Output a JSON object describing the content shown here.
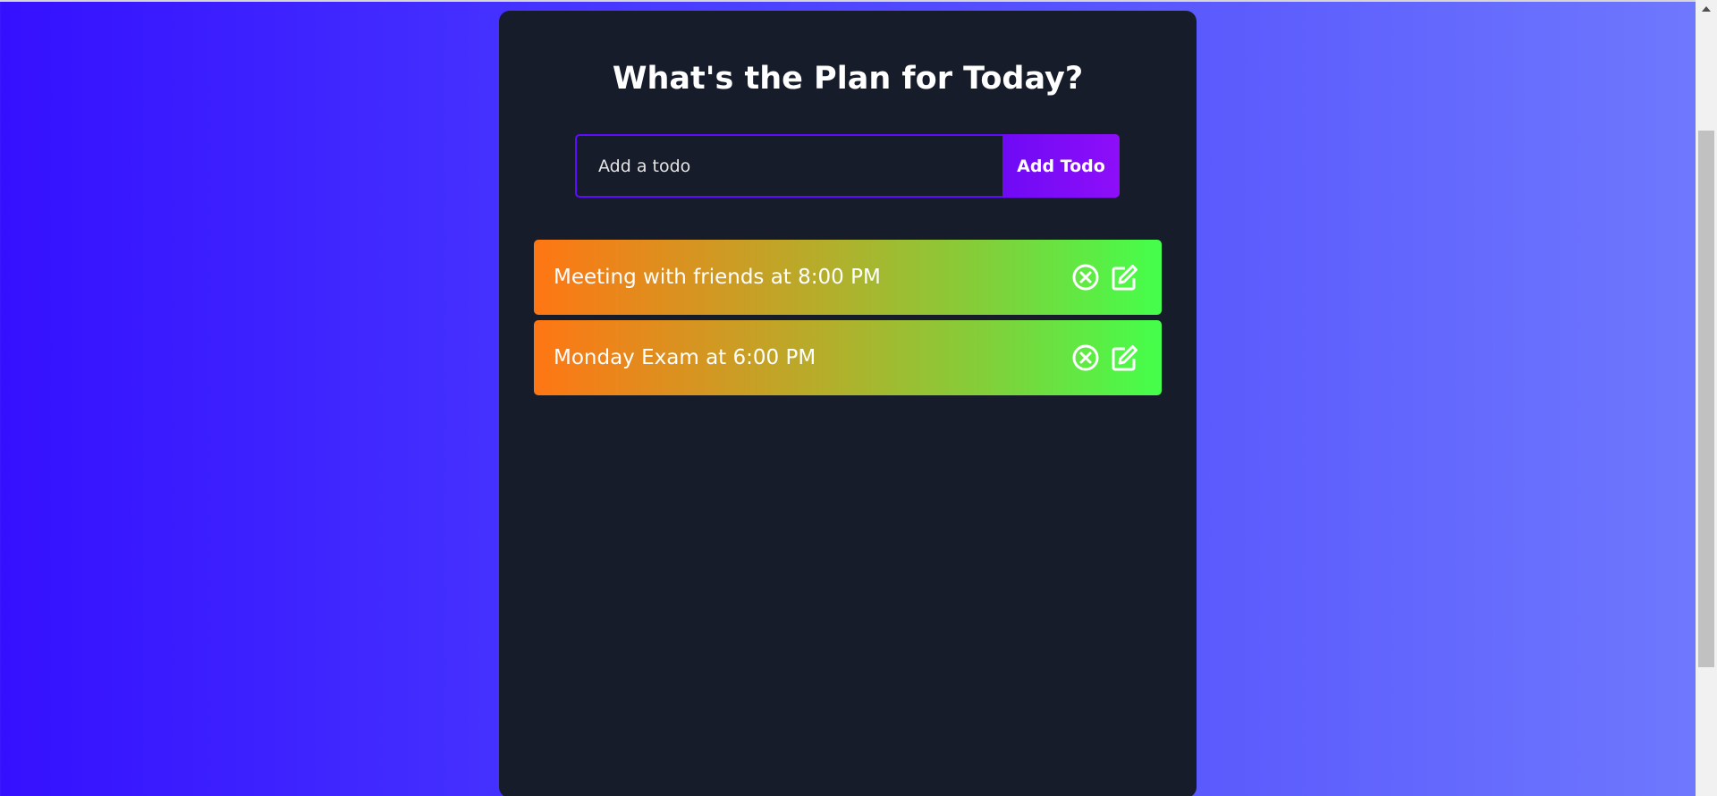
{
  "header": {
    "title": "What's the Plan for Today?"
  },
  "form": {
    "input_placeholder": "Add a todo",
    "input_value": "",
    "add_button_label": "Add Todo"
  },
  "todos": [
    {
      "text": "Meeting with friends at 8:00 PM",
      "delete_icon": "close-circle-icon",
      "edit_icon": "edit-icon"
    },
    {
      "text": "Monday Exam at 6:00 PM",
      "delete_icon": "close-circle-icon",
      "edit_icon": "edit-icon"
    }
  ],
  "colors": {
    "page_gradient_start": "#3510ff",
    "page_gradient_end": "#6f79fd",
    "panel_background": "#171c2b",
    "accent_purple": "#5d0cff",
    "button_gradient_start": "#6f0af5",
    "button_gradient_end": "#8e0ef9",
    "todo_gradient_start": "#ff7614",
    "todo_gradient_end": "#44ff4b",
    "text": "#ffffff"
  }
}
